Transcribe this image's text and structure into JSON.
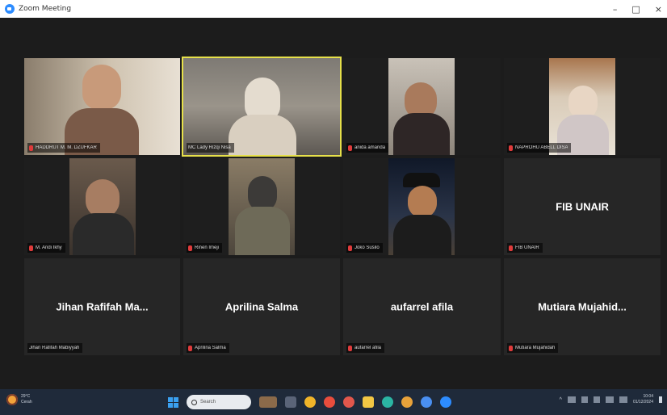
{
  "window": {
    "title": "Zoom Meeting",
    "controls": {
      "minimize": "–",
      "maximize": "□",
      "close": "×"
    }
  },
  "participants": [
    {
      "name": "HADDRUT M. M. DZUFKAR",
      "has_video": true,
      "active": false
    },
    {
      "name": "MC Lady Rizqi Nisa",
      "has_video": true,
      "active": true
    },
    {
      "name": "anida amanda",
      "has_video": true,
      "active": false
    },
    {
      "name": "NAPROHU ABELL DISA",
      "has_video": true,
      "active": false
    },
    {
      "name": "M. Andi Ikhy",
      "has_video": true,
      "active": false
    },
    {
      "name": "Rinen Imeji",
      "has_video": true,
      "active": false
    },
    {
      "name": "Joko Susilo",
      "has_video": true,
      "active": false
    },
    {
      "name": "FIB UNAIR",
      "display": "FIB UNAIR",
      "has_video": false,
      "active": false
    },
    {
      "name": "Jihan Rafifah Mabiyyah",
      "display": "Jihan Rafifah Ma...",
      "has_video": false,
      "active": false
    },
    {
      "name": "Aprilina Salma",
      "display": "Aprilina Salma",
      "has_video": false,
      "active": false
    },
    {
      "name": "aufarrel afila",
      "display": "aufarrel afila",
      "has_video": false,
      "active": false
    },
    {
      "name": "Mutiara Mujahidah",
      "display": "Mutiara Mujahid...",
      "has_video": false,
      "active": false
    }
  ],
  "taskbar": {
    "weather": {
      "temp": "29°C",
      "condition": "Cerah"
    },
    "search_placeholder": "Search",
    "tray": {
      "arrow": "^",
      "lang": "ENG"
    },
    "clock": {
      "time": "10:04",
      "date": "01/12/2024"
    }
  },
  "colors": {
    "active_border": "#e6e04a",
    "mic_muted": "#e03b3b",
    "tile_bg": "#262626",
    "taskbar_bg": "#1f2a3a"
  }
}
